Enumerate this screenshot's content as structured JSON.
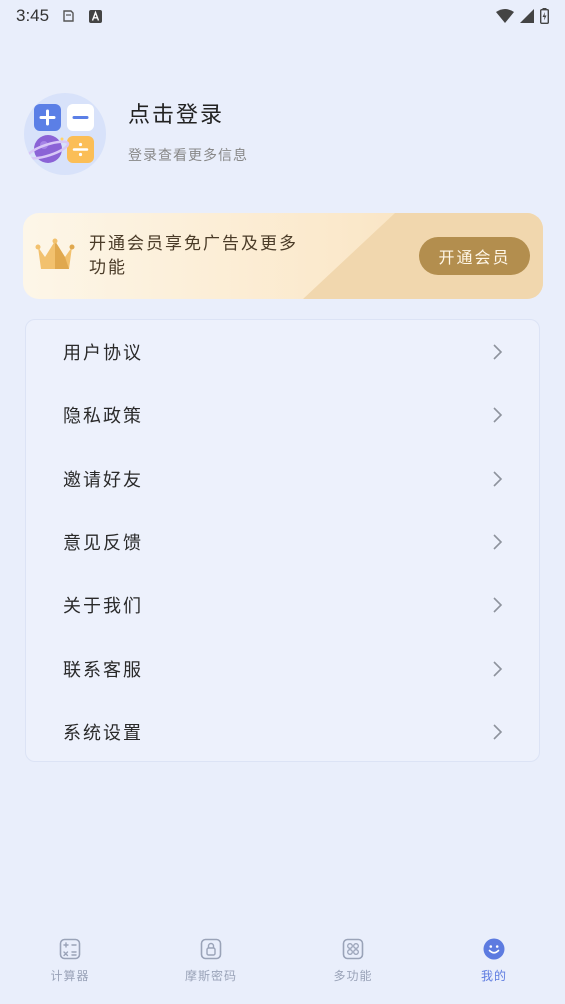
{
  "status_bar": {
    "time": "3:45",
    "icons_left": [
      "notification-icon",
      "a-badge-icon"
    ],
    "icons_right": [
      "wifi-icon",
      "signal-icon",
      "battery-icon"
    ]
  },
  "profile": {
    "title": "点击登录",
    "subtitle": "登录查看更多信息",
    "avatar_icon": "calculator-planet-icon"
  },
  "vip": {
    "text": "开通会员享免广告及更多功能",
    "button_label": "开通会员",
    "icon": "crown-icon",
    "colors": {
      "button": "#B38E4E",
      "bg_light": "#FDF6E8",
      "bg_dark": "#F1D7AE"
    }
  },
  "menu": {
    "items": [
      {
        "label": "用户协议"
      },
      {
        "label": "隐私政策"
      },
      {
        "label": "邀请好友"
      },
      {
        "label": "意见反馈"
      },
      {
        "label": "关于我们"
      },
      {
        "label": "联系客服"
      },
      {
        "label": "系统设置"
      }
    ]
  },
  "bottom_nav": {
    "items": [
      {
        "label": "计算器",
        "icon": "calculator-icon",
        "active": false
      },
      {
        "label": "摩斯密码",
        "icon": "lock-icon",
        "active": false
      },
      {
        "label": "多功能",
        "icon": "grid-icon",
        "active": false
      },
      {
        "label": "我的",
        "icon": "smiley-icon",
        "active": true
      }
    ],
    "active_color": "#5D7BE0",
    "inactive_color": "#9AA3B8"
  }
}
